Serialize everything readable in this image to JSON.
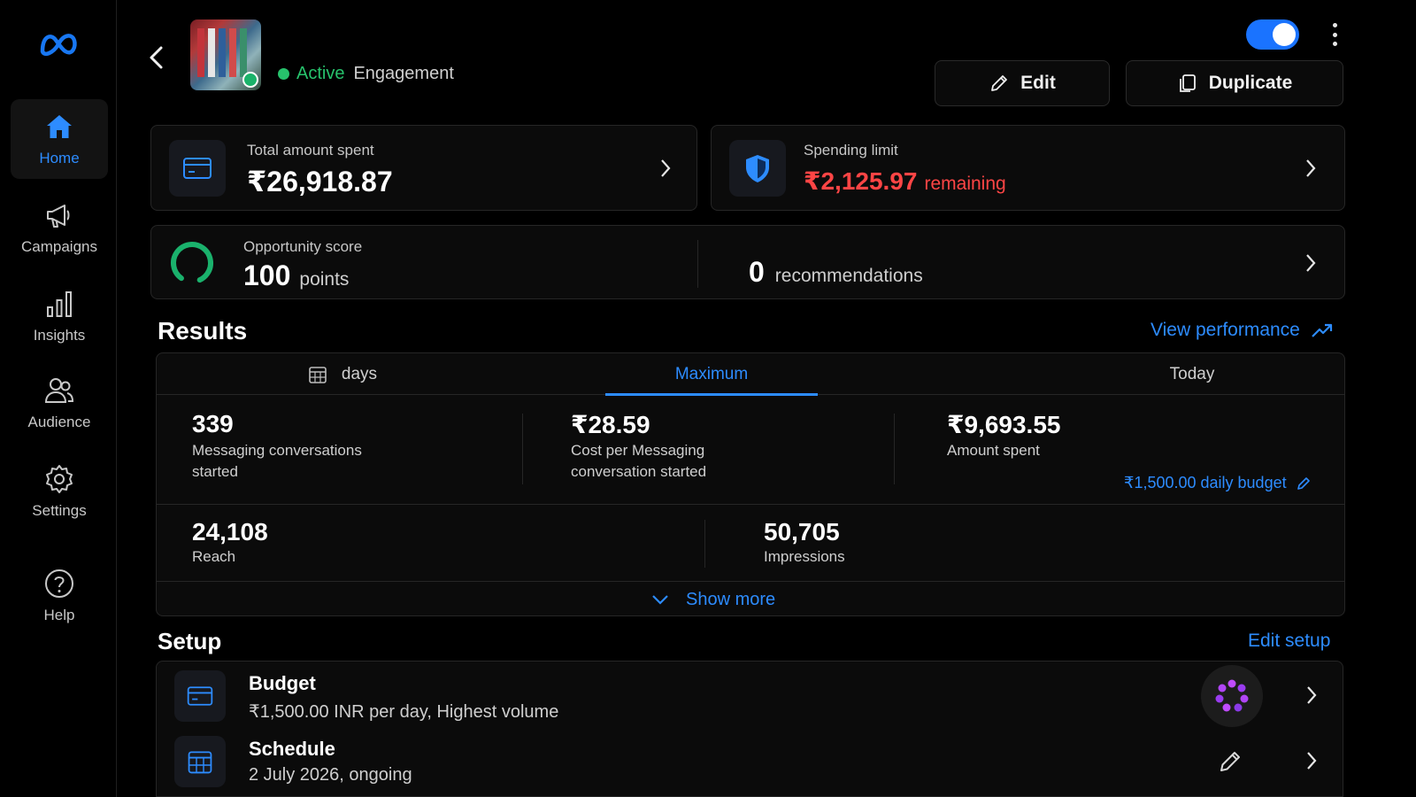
{
  "sidebar": {
    "items": [
      {
        "label": "Home",
        "icon": "home-icon",
        "active": true
      },
      {
        "label": "Campaigns",
        "icon": "megaphone-icon"
      },
      {
        "label": "Insights",
        "icon": "bar-chart-icon"
      },
      {
        "label": "Audience",
        "icon": "people-icon"
      },
      {
        "label": "Settings",
        "icon": "gear-icon"
      },
      {
        "label": "Help",
        "icon": "help-icon"
      }
    ]
  },
  "header": {
    "status": "Active",
    "objective": "Engagement",
    "toggle_on": true,
    "edit_label": "Edit",
    "duplicate_label": "Duplicate"
  },
  "spend": {
    "label": "Total amount spent",
    "value": "₹26,918.87"
  },
  "limit": {
    "label": "Spending limit",
    "value": "₹2,125.97",
    "suffix": "remaining"
  },
  "opportunity": {
    "label": "Opportunity score",
    "value": "100",
    "unit": "points",
    "recommendations_count": "0",
    "recommendations_label": "recommendations"
  },
  "results": {
    "title": "Results",
    "view_performance": "View performance",
    "tabs": [
      {
        "label": "days",
        "icon": "calendar-icon"
      },
      {
        "label": "Maximum",
        "selected": true
      },
      {
        "label": "Today"
      }
    ],
    "metrics": [
      {
        "value": "339",
        "label_line1": "Messaging conversations",
        "label_line2": "started"
      },
      {
        "value": "₹28.59",
        "label_line1": "Cost per Messaging",
        "label_line2": "conversation started"
      },
      {
        "value": "₹9,693.55",
        "label_line1": "Amount spent",
        "label_line2": ""
      },
      {
        "value": "24,108",
        "label_line1": "Reach"
      },
      {
        "value": "50,705",
        "label_line1": "Impressions"
      }
    ],
    "daily_budget": "₹1,500.00 daily budget",
    "show_more": "Show more"
  },
  "setup": {
    "title": "Setup",
    "edit_setup": "Edit setup",
    "rows": [
      {
        "title": "Budget",
        "subtitle": "₹1,500.00 INR per day, Highest volume",
        "icon": "card-icon"
      },
      {
        "title": "Schedule",
        "subtitle": "2 July 2026, ongoing",
        "icon": "calendar-icon"
      }
    ]
  },
  "colors": {
    "accent": "#2d8cff",
    "active": "#27c26c",
    "warning": "#ff4545",
    "background": "#000000"
  }
}
